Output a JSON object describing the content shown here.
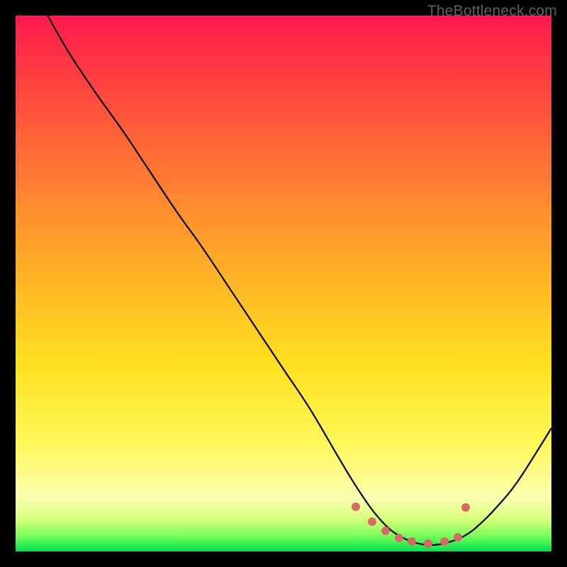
{
  "watermark": "TheBottleneck.com",
  "chart_data": {
    "type": "line",
    "title": "",
    "xlabel": "",
    "ylabel": "",
    "xlim": [
      0,
      100
    ],
    "ylim": [
      0,
      100
    ],
    "grid": false,
    "series": [
      {
        "name": "curve",
        "x": [
          6,
          10,
          15,
          20,
          25,
          30,
          35,
          40,
          45,
          50,
          55,
          60,
          63,
          66,
          68,
          70,
          72,
          74,
          76,
          78,
          80,
          83,
          86,
          90,
          94,
          100
        ],
        "y": [
          100,
          93,
          85.5,
          78.5,
          71,
          63.5,
          56.5,
          49,
          41.5,
          34,
          26.5,
          18,
          13,
          8.5,
          6,
          4,
          2.7,
          1.8,
          1.3,
          1.2,
          1.5,
          2.5,
          4.5,
          8.5,
          13.5,
          23
        ]
      }
    ],
    "markers": {
      "name": "highlight-dots",
      "points": [
        {
          "x": 63.5,
          "y": 8.3
        },
        {
          "x": 66.5,
          "y": 5.5
        },
        {
          "x": 69.0,
          "y": 3.8
        },
        {
          "x": 71.5,
          "y": 2.5
        },
        {
          "x": 74.0,
          "y": 1.8
        },
        {
          "x": 77.0,
          "y": 1.4
        },
        {
          "x": 80.0,
          "y": 1.8
        },
        {
          "x": 82.5,
          "y": 2.6
        },
        {
          "x": 84.0,
          "y": 8.2
        }
      ]
    },
    "colors": {
      "curve": "#000000",
      "markers": "#d96a63",
      "gradient_top": "#ff1a4d",
      "gradient_bottom": "#00e24a"
    }
  }
}
